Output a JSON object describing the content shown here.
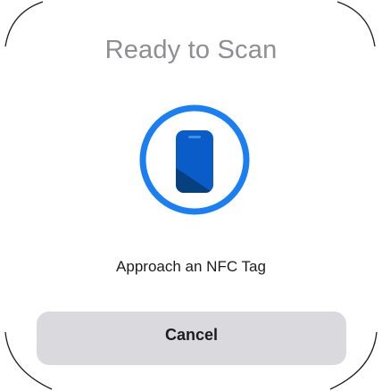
{
  "sheet": {
    "title": "Ready to Scan",
    "instruction": "Approach an NFC Tag",
    "cancel_label": "Cancel"
  },
  "icon": {
    "name": "nfc-phone-icon",
    "ring_color": "#1a7ef5",
    "phone_color": "#0a5dc9"
  },
  "colors": {
    "title": "#8e8e93",
    "text": "#1c1c1e",
    "button_bg": "#d9d9de"
  }
}
